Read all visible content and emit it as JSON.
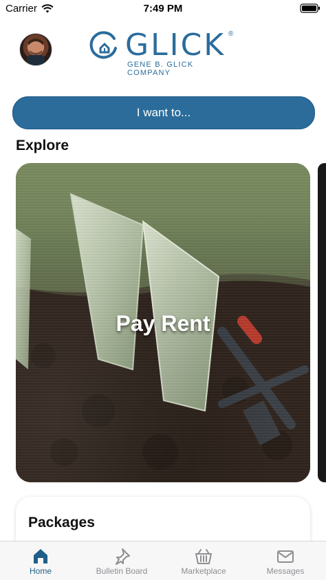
{
  "status_bar": {
    "carrier": "Carrier",
    "time": "7:49 PM"
  },
  "header": {
    "logo_text": "GLICK",
    "logo_registered": "®",
    "logo_subtitle": "GENE B. GLICK COMPANY"
  },
  "actions": {
    "iwant_label": "I want to..."
  },
  "explore": {
    "title": "Explore",
    "cards": [
      {
        "title": "Pay Rent"
      }
    ]
  },
  "packages": {
    "title": "Packages"
  },
  "tabs": [
    {
      "label": "Home",
      "icon": "home-icon",
      "active": true
    },
    {
      "label": "Bulletin Board",
      "icon": "pushpin-icon",
      "active": false
    },
    {
      "label": "Marketplace",
      "icon": "basket-icon",
      "active": false
    },
    {
      "label": "Messages",
      "icon": "envelope-icon",
      "active": false
    }
  ],
  "colors": {
    "brand": "#2b6c9b",
    "tab_active": "#1f5f8a",
    "tab_inactive": "#8e8e93"
  }
}
